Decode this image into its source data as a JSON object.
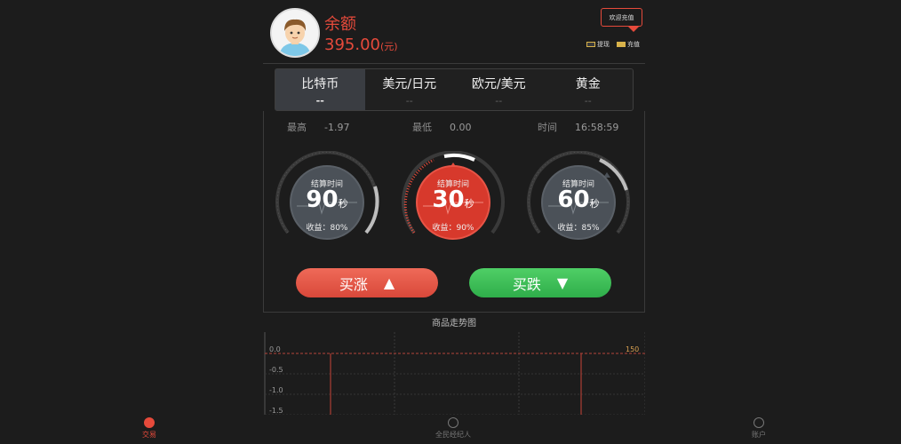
{
  "account": {
    "balance_label": "余额",
    "balance_value": "395.00",
    "balance_unit": "(元)",
    "welcome_button": "欢迎充值",
    "withdraw_label": "提现",
    "recharge_label": "充值"
  },
  "tabs": [
    {
      "label": "比特币",
      "value": "--",
      "active": true
    },
    {
      "label": "美元/日元",
      "value": "--",
      "active": false
    },
    {
      "label": "欧元/美元",
      "value": "--",
      "active": false
    },
    {
      "label": "黄金",
      "value": "--",
      "active": false
    }
  ],
  "stats": {
    "high_label": "最高",
    "high_value": "-1.97",
    "low_label": "最低",
    "low_value": "0.00",
    "time_label": "时间",
    "time_value": "16:58:59"
  },
  "dials": [
    {
      "caption": "结算时间",
      "seconds": "90",
      "unit": "秒",
      "yield": "收益：80%",
      "active": false
    },
    {
      "caption": "结算时间",
      "seconds": "30",
      "unit": "秒",
      "yield": "收益：90%",
      "active": true
    },
    {
      "caption": "结算时间",
      "seconds": "60",
      "unit": "秒",
      "yield": "收益：85%",
      "active": false
    }
  ],
  "actions": {
    "buy_up_label": "买涨",
    "buy_up_arrow": "▲",
    "buy_down_label": "买跌",
    "buy_down_arrow": "▼"
  },
  "chart_data": {
    "type": "line",
    "title": "商品走势图",
    "y_ticks": [
      "0.0",
      "-0.5",
      "-1.0",
      "-1.5"
    ],
    "right_label": "150",
    "ylim": [
      -1.5,
      0.0
    ]
  },
  "nav": {
    "trade": "交易",
    "agent": "全民经纪人",
    "account": "账户"
  },
  "colors": {
    "accent": "#e64a3b",
    "up": "#e64a3b",
    "down": "#37b850"
  }
}
